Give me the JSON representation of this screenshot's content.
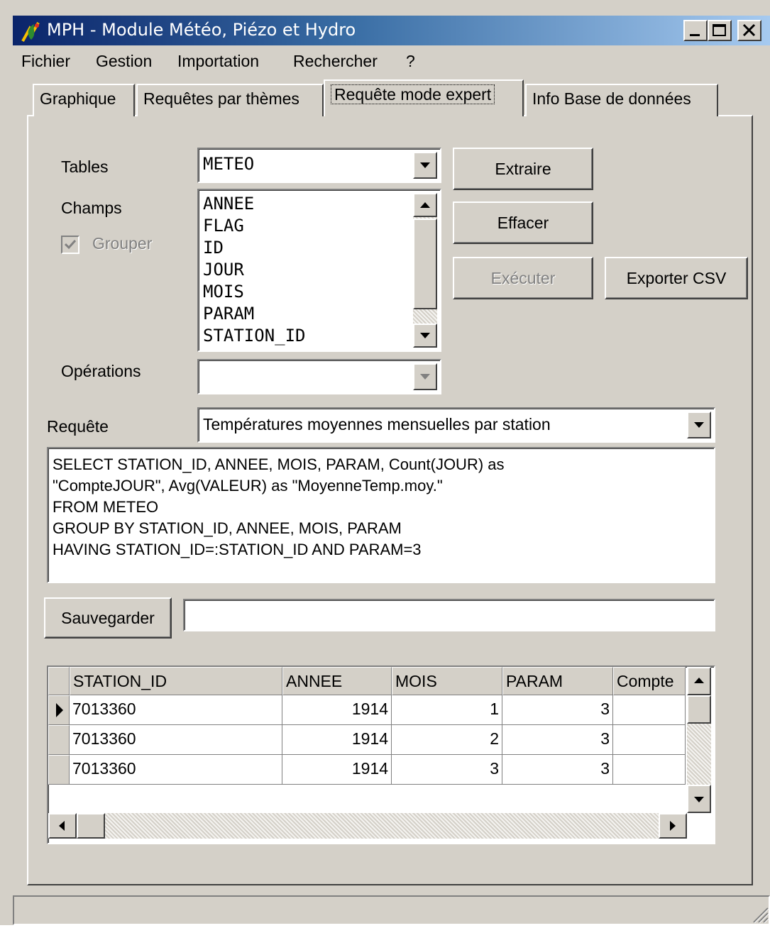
{
  "window": {
    "title": "MPH - Module Météo, Piézo et Hydro",
    "controls": [
      "minimize-icon",
      "maximize-icon",
      "close-icon"
    ]
  },
  "menu": [
    "Fichier",
    "Gestion",
    "Importation",
    "Rechercher",
    "?"
  ],
  "tabs": [
    {
      "label": "Graphique",
      "active": false
    },
    {
      "label": "Requêtes par thèmes",
      "active": false
    },
    {
      "label": "Requête mode expert",
      "active": true
    },
    {
      "label": "Info Base de données",
      "active": false
    }
  ],
  "form": {
    "tables_label": "Tables",
    "tables_value": "METEO",
    "champs_label": "Champs",
    "champs_items": [
      "ANNEE",
      "FLAG",
      "ID",
      "JOUR",
      "MOIS",
      "PARAM",
      "STATION_ID"
    ],
    "grouper_label": "Grouper",
    "grouper_checked": true,
    "operations_label": "Opérations",
    "operations_value": "",
    "requete_label": "Requête",
    "requete_value": "Températures moyennes mensuelles par station",
    "sql_lines": [
      "SELECT STATION_ID, ANNEE, MOIS, PARAM, Count(JOUR) as",
      "\"CompteJOUR\", Avg(VALEUR) as \"MoyenneTemp.moy.\"",
      "FROM METEO",
      "GROUP BY STATION_ID, ANNEE, MOIS, PARAM",
      "HAVING STATION_ID=:STATION_ID AND PARAM=3"
    ],
    "save_name_value": ""
  },
  "buttons": {
    "extraire": "Extraire",
    "effacer": "Effacer",
    "executer": "Exécuter",
    "exporter": "Exporter CSV",
    "sauvegarder": "Sauvegarder"
  },
  "grid": {
    "columns": [
      "STATION_ID",
      "ANNEE",
      "MOIS",
      "PARAM",
      "Compte"
    ],
    "rows": [
      [
        "7013360",
        "1914",
        "1",
        "3",
        ""
      ],
      [
        "7013360",
        "1914",
        "2",
        "3",
        ""
      ],
      [
        "7013360",
        "1914",
        "3",
        "3",
        ""
      ]
    ],
    "current_row": 0
  },
  "colors": {
    "face": "#d4d0c8",
    "title_start": "#0a246a",
    "title_end": "#a6caf0",
    "disabled_text": "#808080"
  }
}
